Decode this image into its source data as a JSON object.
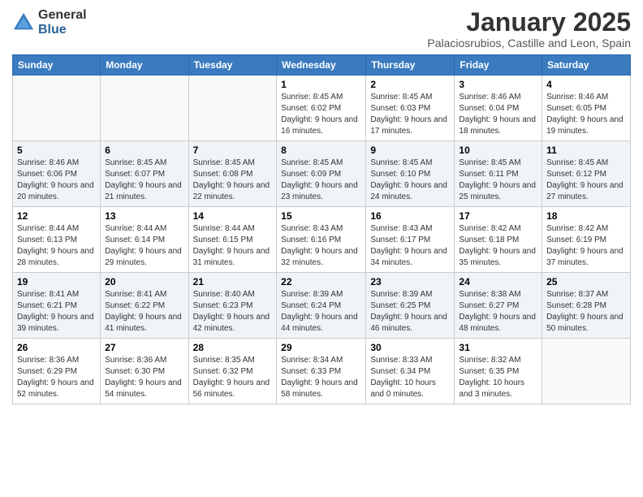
{
  "logo": {
    "general": "General",
    "blue": "Blue"
  },
  "header": {
    "month": "January 2025",
    "location": "Palaciosrubios, Castille and Leon, Spain"
  },
  "weekdays": [
    "Sunday",
    "Monday",
    "Tuesday",
    "Wednesday",
    "Thursday",
    "Friday",
    "Saturday"
  ],
  "weeks": [
    [
      {
        "day": "",
        "info": ""
      },
      {
        "day": "",
        "info": ""
      },
      {
        "day": "",
        "info": ""
      },
      {
        "day": "1",
        "info": "Sunrise: 8:45 AM\nSunset: 6:02 PM\nDaylight: 9 hours and 16 minutes."
      },
      {
        "day": "2",
        "info": "Sunrise: 8:45 AM\nSunset: 6:03 PM\nDaylight: 9 hours and 17 minutes."
      },
      {
        "day": "3",
        "info": "Sunrise: 8:46 AM\nSunset: 6:04 PM\nDaylight: 9 hours and 18 minutes."
      },
      {
        "day": "4",
        "info": "Sunrise: 8:46 AM\nSunset: 6:05 PM\nDaylight: 9 hours and 19 minutes."
      }
    ],
    [
      {
        "day": "5",
        "info": "Sunrise: 8:46 AM\nSunset: 6:06 PM\nDaylight: 9 hours and 20 minutes."
      },
      {
        "day": "6",
        "info": "Sunrise: 8:45 AM\nSunset: 6:07 PM\nDaylight: 9 hours and 21 minutes."
      },
      {
        "day": "7",
        "info": "Sunrise: 8:45 AM\nSunset: 6:08 PM\nDaylight: 9 hours and 22 minutes."
      },
      {
        "day": "8",
        "info": "Sunrise: 8:45 AM\nSunset: 6:09 PM\nDaylight: 9 hours and 23 minutes."
      },
      {
        "day": "9",
        "info": "Sunrise: 8:45 AM\nSunset: 6:10 PM\nDaylight: 9 hours and 24 minutes."
      },
      {
        "day": "10",
        "info": "Sunrise: 8:45 AM\nSunset: 6:11 PM\nDaylight: 9 hours and 25 minutes."
      },
      {
        "day": "11",
        "info": "Sunrise: 8:45 AM\nSunset: 6:12 PM\nDaylight: 9 hours and 27 minutes."
      }
    ],
    [
      {
        "day": "12",
        "info": "Sunrise: 8:44 AM\nSunset: 6:13 PM\nDaylight: 9 hours and 28 minutes."
      },
      {
        "day": "13",
        "info": "Sunrise: 8:44 AM\nSunset: 6:14 PM\nDaylight: 9 hours and 29 minutes."
      },
      {
        "day": "14",
        "info": "Sunrise: 8:44 AM\nSunset: 6:15 PM\nDaylight: 9 hours and 31 minutes."
      },
      {
        "day": "15",
        "info": "Sunrise: 8:43 AM\nSunset: 6:16 PM\nDaylight: 9 hours and 32 minutes."
      },
      {
        "day": "16",
        "info": "Sunrise: 8:43 AM\nSunset: 6:17 PM\nDaylight: 9 hours and 34 minutes."
      },
      {
        "day": "17",
        "info": "Sunrise: 8:42 AM\nSunset: 6:18 PM\nDaylight: 9 hours and 35 minutes."
      },
      {
        "day": "18",
        "info": "Sunrise: 8:42 AM\nSunset: 6:19 PM\nDaylight: 9 hours and 37 minutes."
      }
    ],
    [
      {
        "day": "19",
        "info": "Sunrise: 8:41 AM\nSunset: 6:21 PM\nDaylight: 9 hours and 39 minutes."
      },
      {
        "day": "20",
        "info": "Sunrise: 8:41 AM\nSunset: 6:22 PM\nDaylight: 9 hours and 41 minutes."
      },
      {
        "day": "21",
        "info": "Sunrise: 8:40 AM\nSunset: 6:23 PM\nDaylight: 9 hours and 42 minutes."
      },
      {
        "day": "22",
        "info": "Sunrise: 8:39 AM\nSunset: 6:24 PM\nDaylight: 9 hours and 44 minutes."
      },
      {
        "day": "23",
        "info": "Sunrise: 8:39 AM\nSunset: 6:25 PM\nDaylight: 9 hours and 46 minutes."
      },
      {
        "day": "24",
        "info": "Sunrise: 8:38 AM\nSunset: 6:27 PM\nDaylight: 9 hours and 48 minutes."
      },
      {
        "day": "25",
        "info": "Sunrise: 8:37 AM\nSunset: 6:28 PM\nDaylight: 9 hours and 50 minutes."
      }
    ],
    [
      {
        "day": "26",
        "info": "Sunrise: 8:36 AM\nSunset: 6:29 PM\nDaylight: 9 hours and 52 minutes."
      },
      {
        "day": "27",
        "info": "Sunrise: 8:36 AM\nSunset: 6:30 PM\nDaylight: 9 hours and 54 minutes."
      },
      {
        "day": "28",
        "info": "Sunrise: 8:35 AM\nSunset: 6:32 PM\nDaylight: 9 hours and 56 minutes."
      },
      {
        "day": "29",
        "info": "Sunrise: 8:34 AM\nSunset: 6:33 PM\nDaylight: 9 hours and 58 minutes."
      },
      {
        "day": "30",
        "info": "Sunrise: 8:33 AM\nSunset: 6:34 PM\nDaylight: 10 hours and 0 minutes."
      },
      {
        "day": "31",
        "info": "Sunrise: 8:32 AM\nSunset: 6:35 PM\nDaylight: 10 hours and 3 minutes."
      },
      {
        "day": "",
        "info": ""
      }
    ]
  ]
}
